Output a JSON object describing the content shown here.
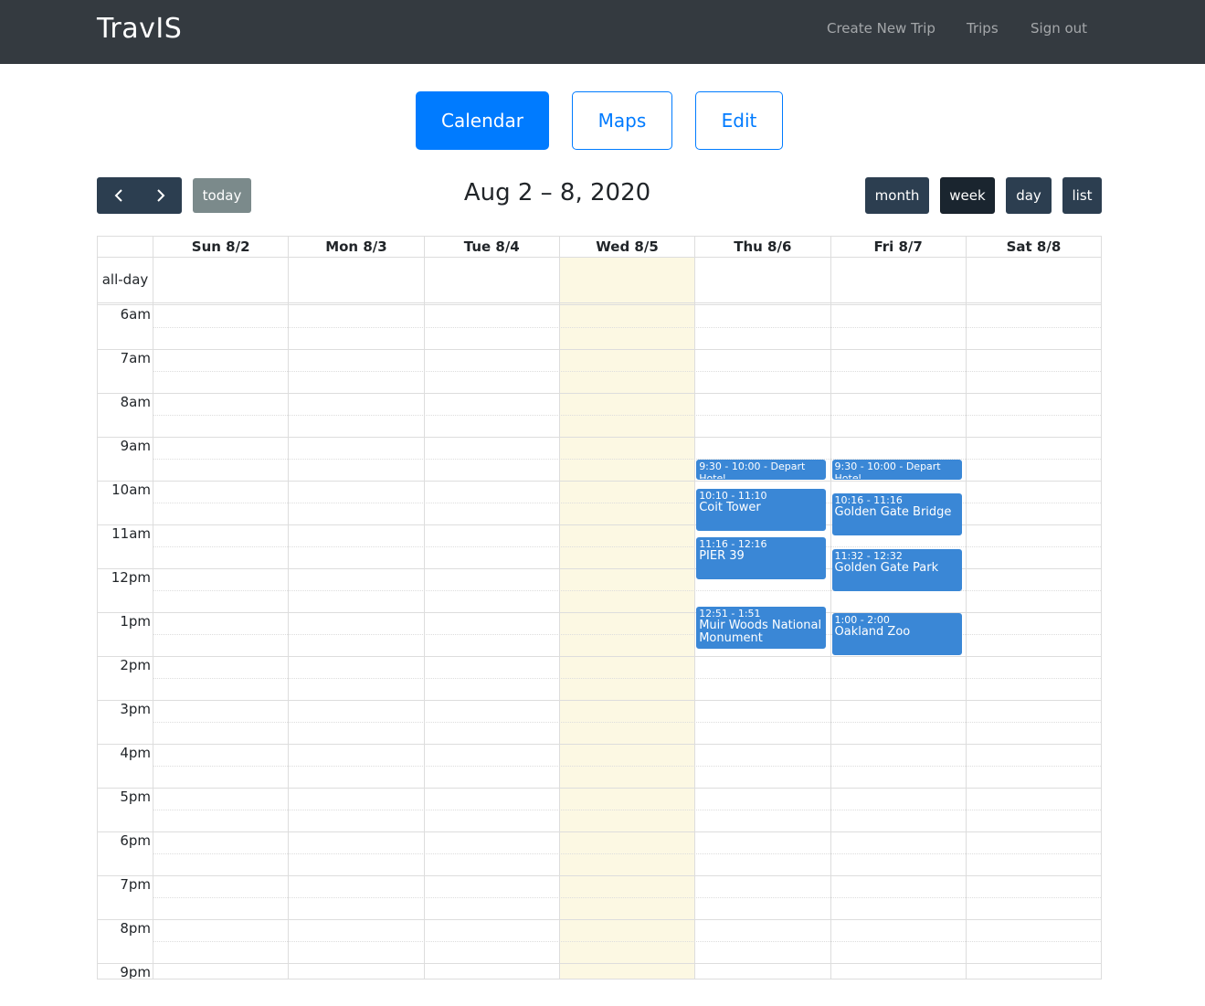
{
  "navbar": {
    "brand": "TravIS",
    "links": [
      "Create New Trip",
      "Trips",
      "Sign out"
    ]
  },
  "views": {
    "calendar": "Calendar",
    "maps": "Maps",
    "edit": "Edit"
  },
  "toolbar": {
    "prev_icon": "chevron-left-icon",
    "next_icon": "chevron-right-icon",
    "today": "today",
    "title": "Aug 2 – 8, 2020",
    "view_month": "month",
    "view_week": "week",
    "view_day": "day",
    "view_list": "list",
    "active_view": "week"
  },
  "calendar": {
    "days": [
      "Sun 8/2",
      "Mon 8/3",
      "Tue 8/4",
      "Wed 8/5",
      "Thu 8/6",
      "Fri 8/7",
      "Sat 8/8"
    ],
    "today": "Wed 8/5",
    "allday_label": "all-day",
    "hours": [
      "6am",
      "7am",
      "8am",
      "9am",
      "10am",
      "11am",
      "12pm",
      "1pm",
      "2pm",
      "3pm",
      "4pm",
      "5pm",
      "6pm",
      "7pm",
      "8pm",
      "9pm"
    ],
    "events": [
      {
        "day": "Thu 8/6",
        "time": "9:30 - 10:00",
        "title": "Depart Hotel",
        "start": 9.5,
        "end": 10.0
      },
      {
        "day": "Thu 8/6",
        "time": "10:10 - 11:10",
        "title": "Coit Tower",
        "start": 10.1667,
        "end": 11.1667
      },
      {
        "day": "Thu 8/6",
        "time": "11:16 - 12:16",
        "title": "PIER 39",
        "start": 11.2667,
        "end": 12.2667
      },
      {
        "day": "Thu 8/6",
        "time": "12:51 - 1:51",
        "title": "Muir Woods National Monument",
        "start": 12.85,
        "end": 13.85
      },
      {
        "day": "Fri 8/7",
        "time": "9:30 - 10:00",
        "title": "Depart Hotel",
        "start": 9.5,
        "end": 10.0
      },
      {
        "day": "Fri 8/7",
        "time": "10:16 - 11:16",
        "title": "Golden Gate Bridge",
        "start": 10.2667,
        "end": 11.2667
      },
      {
        "day": "Fri 8/7",
        "time": "11:32 - 12:32",
        "title": "Golden Gate Park",
        "start": 11.5333,
        "end": 12.5333
      },
      {
        "day": "Fri 8/7",
        "time": "1:00 - 2:00",
        "title": "Oakland Zoo",
        "start": 13.0,
        "end": 14.0
      }
    ]
  },
  "colors": {
    "navbar": "#343a40",
    "primary": "#007bff",
    "event": "#3a87d6",
    "today_highlight": "#fcf8e3",
    "toolbar_button": "#2c3e50"
  }
}
